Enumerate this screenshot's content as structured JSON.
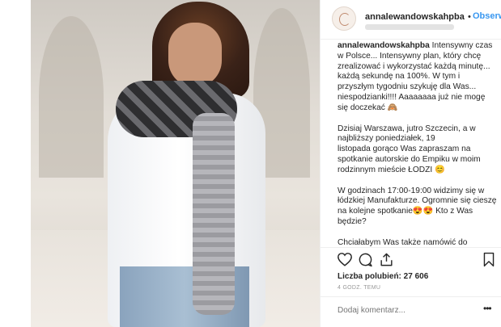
{
  "post": {
    "username": "annalewandowskahpba",
    "separator": "•",
    "follow_label": "Obserwuj",
    "caption": {
      "username": "annalewandowskahpba",
      "paragraphs": [
        "Intensywny czas w Polsce... Intensywny plan, który chcę zrealizować i wykorzystać każdą minutę... każdą sekundę na 100%. W tym i przyszłym tygodniu szykuję dla Was... niespodzianki!!!! Aaaaaaaa już nie mogę się doczekać 🙈",
        "Dzisiaj Warszawa, jutro Szczecin, a w najbliższy poniedziałek, 19\nlistopada gorąco Was zapraszam na spotkanie autorskie do Empiku w moim rodzinnym mieście ŁODZI 😊",
        "W godzinach 17:00-19:00 widzimy się w łódzkiej Manufakturze. Ogromnie się cieszę na kolejne spotkanie😍😍 Kto z Was będzie?",
        "Chciałabym Was także namówić do"
      ]
    },
    "likes_label": "Liczba polubień: 27 606",
    "time_label": "4 GODZ. TEMU",
    "comment_placeholder": "Dodaj komentarz...",
    "more_label": "•••"
  },
  "icons": {
    "like": "heart-outline-icon",
    "comment": "speech-bubble-icon",
    "share": "share-arrow-icon",
    "save": "bookmark-icon"
  },
  "colors": {
    "link_blue": "#3897f0",
    "muted_gray": "#999999",
    "text": "#262626"
  }
}
